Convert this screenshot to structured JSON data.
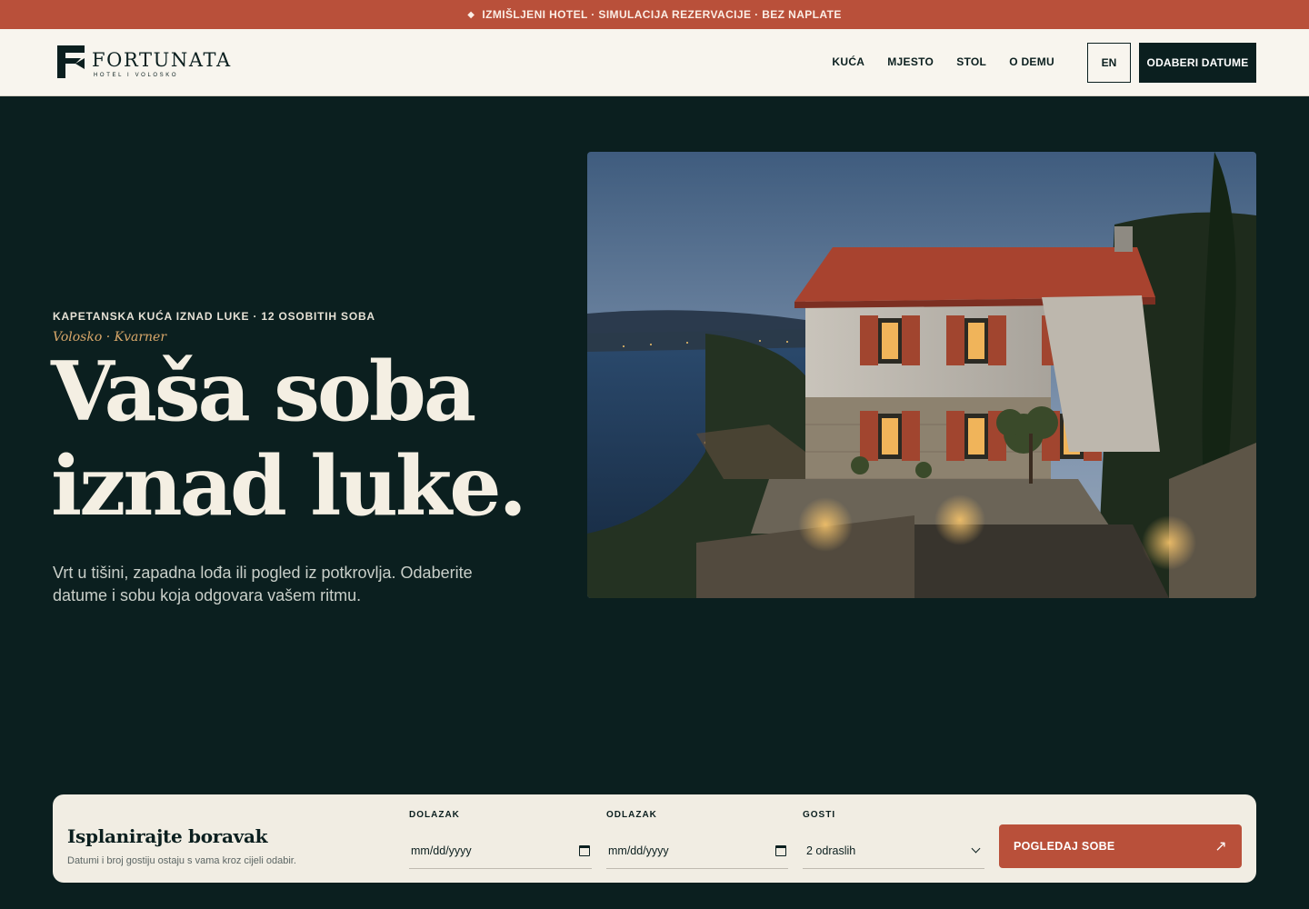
{
  "announcement": {
    "icon": "diamond-icon",
    "text": "IZMIŠLJENI HOTEL · SIMULACIJA REZERVACIJE · BEZ NAPLATE"
  },
  "brand": {
    "name": "FORTUNATA",
    "tagline": "HOTEL I VOLOSKO"
  },
  "nav": {
    "links": [
      "KUĆA",
      "MJESTO",
      "STOL",
      "O DEMU"
    ],
    "language": "EN",
    "cta": "ODABERI DATUME"
  },
  "hero": {
    "eyebrow": "KAPETANSKA KUĆA IZNAD LUKE · 12 OSOBITIH SOBA",
    "location": "Volosko · Kvarner",
    "headline_line1": "Vaša soba",
    "headline_line2": "iznad luke.",
    "description": "Vrt u tišini, zapadna lođa ili pogled iz potkrovlja. Odaberite datume i sobu koja odgovara vašem ritmu."
  },
  "booking": {
    "title": "Isplanirajte boravak",
    "subtitle": "Datumi i broj gostiju ostaju s vama kroz cijeli odabir.",
    "arrival": {
      "label": "DOLAZAK",
      "placeholder": "mm/dd/yyyy",
      "icon": "calendar-icon"
    },
    "departure": {
      "label": "ODLAZAK",
      "placeholder": "mm/dd/yyyy",
      "icon": "calendar-icon"
    },
    "guests": {
      "label": "GOSTI",
      "value": "2 odraslih",
      "icon": "chevron-down-icon"
    },
    "submit": {
      "label": "POGLEDAJ SOBE",
      "icon": "arrow-up-right-icon"
    }
  },
  "colors": {
    "accent": "#b9503a",
    "dark": "#0b1f1f",
    "cream": "#f8f5ee",
    "gold": "#d9a86a"
  }
}
